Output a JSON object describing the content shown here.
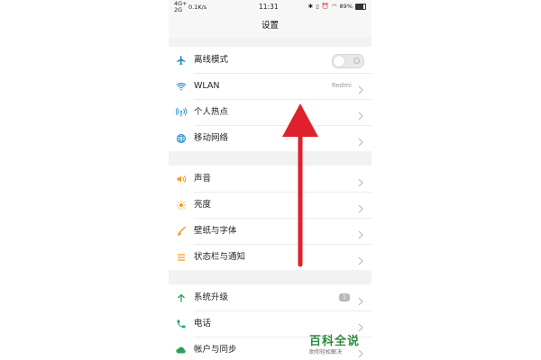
{
  "status": {
    "net_top": "4G+",
    "net_bottom": "2G",
    "speed": "0.1K/s",
    "time": "11:31",
    "battery": "89%"
  },
  "title": "设置",
  "sections": [
    [
      {
        "label": "离线模式",
        "icon": "airplane-icon",
        "control": "toggle"
      },
      {
        "label": "WLAN",
        "icon": "wifi-icon",
        "value": "Redmi"
      },
      {
        "label": "个人热点",
        "icon": "hotspot-icon"
      },
      {
        "label": "移动网络",
        "icon": "globe-icon"
      }
    ],
    [
      {
        "label": "声音",
        "icon": "speaker-icon"
      },
      {
        "label": "亮度",
        "icon": "sun-icon"
      },
      {
        "label": "壁纸与字体",
        "icon": "brush-icon"
      },
      {
        "label": "状态栏与通知",
        "icon": "list-icon"
      }
    ],
    [
      {
        "label": "系统升级",
        "icon": "up-arrow-icon",
        "badge": "1"
      },
      {
        "label": "电话",
        "icon": "phone-icon"
      },
      {
        "label": "帐户与同步",
        "icon": "cloud-icon"
      }
    ]
  ],
  "watermark": {
    "main": "百科全说",
    "sub": "助你轻松解决"
  },
  "colors": {
    "accent_blue": "#1e88c8",
    "orange": "#f39a1e",
    "green": "#2aa05a",
    "arrow_red": "#e0202a"
  }
}
